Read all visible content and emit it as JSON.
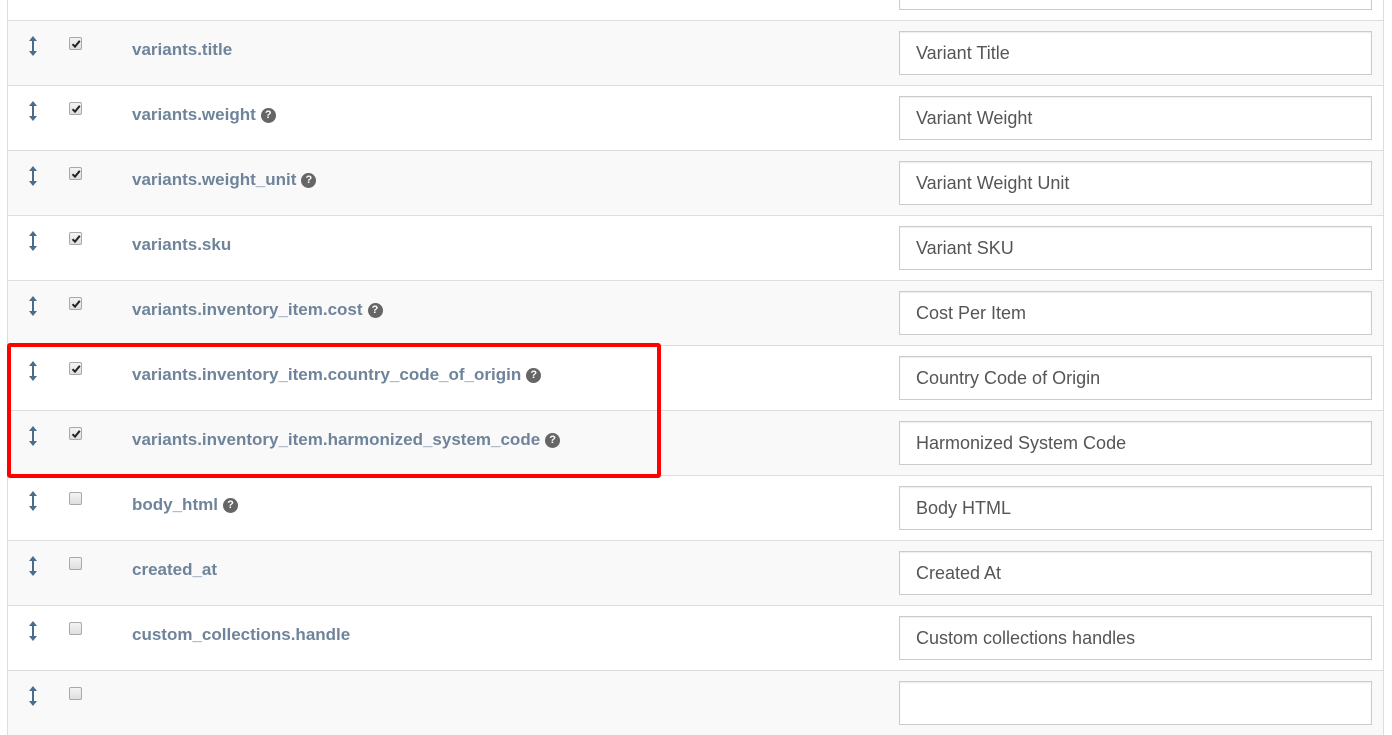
{
  "columns": {
    "sort_icon": "sort-vertical-icon",
    "enabled_icon": "checkbox",
    "help_icon": "question-circle-icon"
  },
  "rows": [
    {
      "field": "",
      "enabled": true,
      "help": false,
      "label": ""
    },
    {
      "field": "variants.title",
      "enabled": true,
      "help": false,
      "label": "Variant Title"
    },
    {
      "field": "variants.weight",
      "enabled": true,
      "help": true,
      "label": "Variant Weight"
    },
    {
      "field": "variants.weight_unit",
      "enabled": true,
      "help": true,
      "label": "Variant Weight Unit"
    },
    {
      "field": "variants.sku",
      "enabled": true,
      "help": false,
      "label": "Variant SKU"
    },
    {
      "field": "variants.inventory_item.cost",
      "enabled": true,
      "help": true,
      "label": "Cost Per Item"
    },
    {
      "field": "variants.inventory_item.country_code_of_origin",
      "enabled": true,
      "help": true,
      "label": "Country Code of Origin"
    },
    {
      "field": "variants.inventory_item.harmonized_system_code",
      "enabled": true,
      "help": true,
      "label": "Harmonized System Code"
    },
    {
      "field": "body_html",
      "enabled": false,
      "help": true,
      "label": "Body HTML"
    },
    {
      "field": "created_at",
      "enabled": false,
      "help": false,
      "label": "Created At"
    },
    {
      "field": "custom_collections.handle",
      "enabled": false,
      "help": false,
      "label": "Custom collections handles"
    },
    {
      "field": "",
      "enabled": false,
      "help": false,
      "label": ""
    }
  ],
  "highlight": {
    "rows": [
      "variants.inventory_item.country_code_of_origin",
      "variants.inventory_item.harmonized_system_code"
    ],
    "color": "#ff0000"
  },
  "help_glyph": "?"
}
